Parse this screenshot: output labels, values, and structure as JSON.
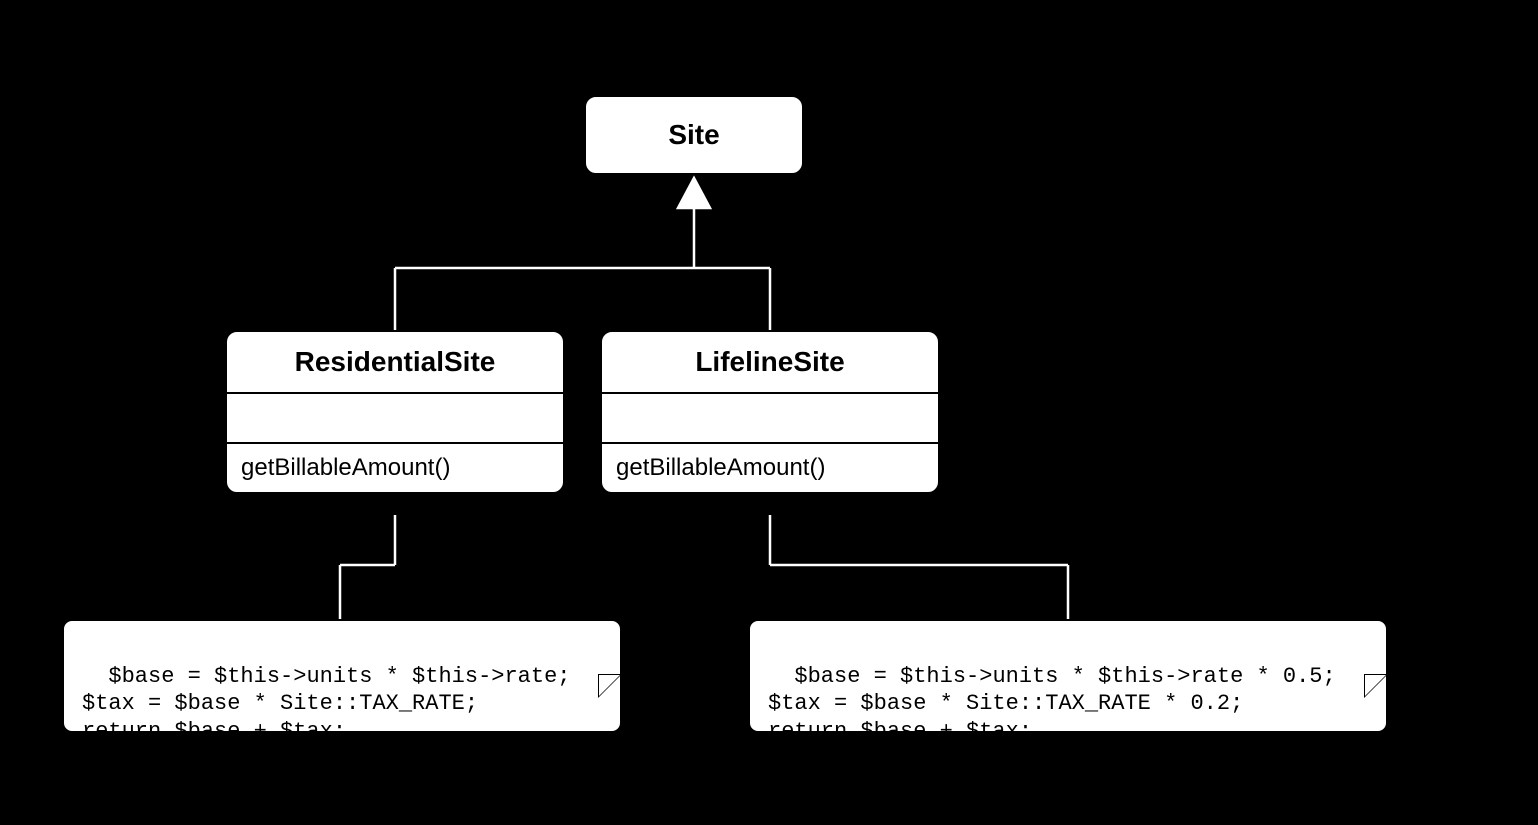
{
  "parent": {
    "name": "Site"
  },
  "left": {
    "name": "ResidentialSite",
    "method": "getBillableAmount()",
    "code": "$base = $this->units * $this->rate;\n$tax = $base * Site::TAX_RATE;\nreturn $base + $tax;"
  },
  "right": {
    "name": "LifelineSite",
    "method": "getBillableAmount()",
    "code": "$base = $this->units * $this->rate * 0.5;\n$tax = $base * Site::TAX_RATE * 0.2;\nreturn $base + $tax;"
  }
}
